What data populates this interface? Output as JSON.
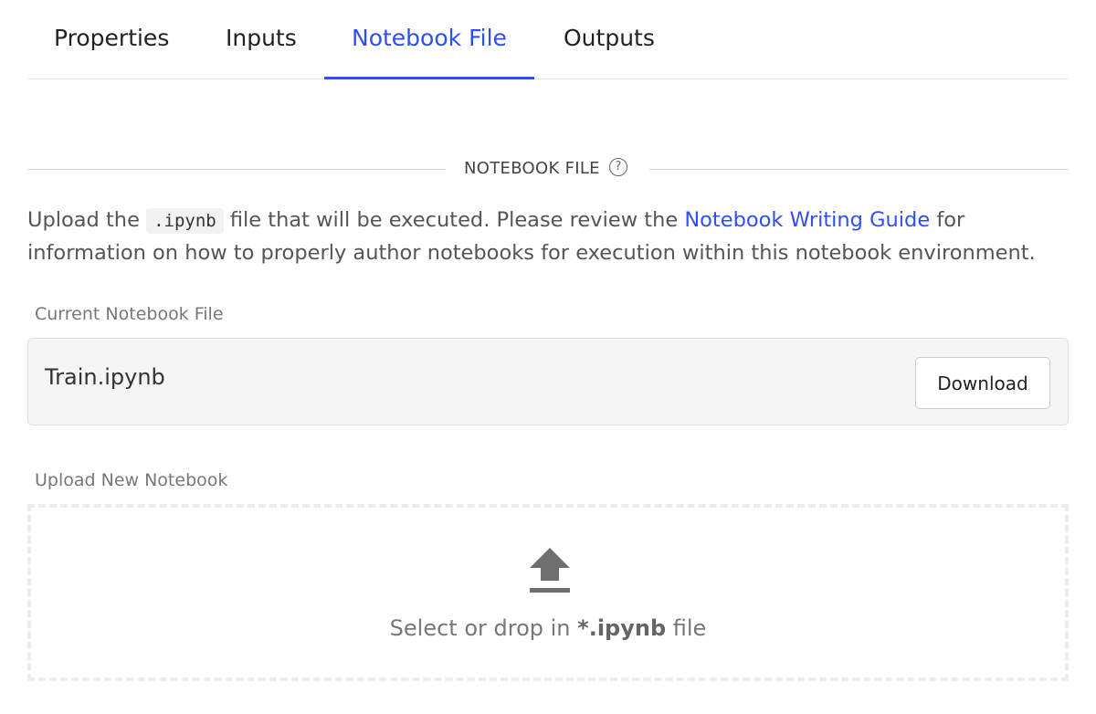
{
  "tabs": [
    {
      "label": "Properties",
      "active": false
    },
    {
      "label": "Inputs",
      "active": false
    },
    {
      "label": "Notebook File",
      "active": true
    },
    {
      "label": "Outputs",
      "active": false
    }
  ],
  "section": {
    "title": "NOTEBOOK FILE",
    "help_icon": "question-circle-icon",
    "help_glyph": "?"
  },
  "description": {
    "prefix": "Upload the ",
    "code": ".ipynb",
    "middle": " file that will be executed. Please review the ",
    "link_text": "Notebook Writing Guide",
    "suffix": " for information on how to properly author notebooks for execution within this notebook environment."
  },
  "current_file": {
    "label": "Current Notebook File",
    "file_name": "Train.ipynb",
    "download_label": "Download"
  },
  "upload": {
    "label": "Upload New Notebook",
    "icon": "upload-icon",
    "text_prefix": "Select or drop in ",
    "text_bold": "*.ipynb",
    "text_suffix": " file"
  },
  "colors": {
    "accent": "#2f4ff2",
    "text": "#333333",
    "muted": "#777777"
  }
}
